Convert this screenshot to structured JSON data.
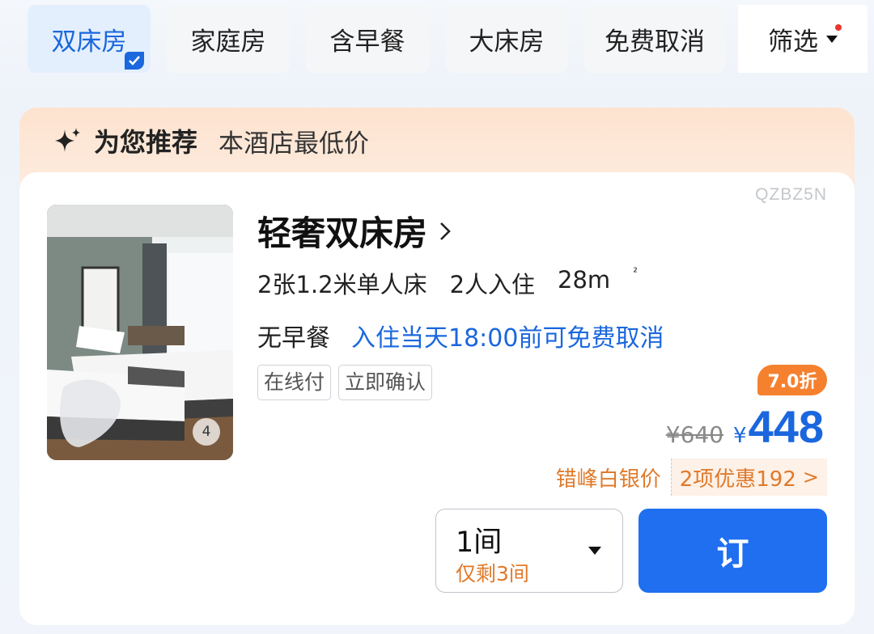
{
  "filters": {
    "chips": [
      {
        "label": "双床房",
        "active": true
      },
      {
        "label": "家庭房",
        "active": false
      },
      {
        "label": "含早餐",
        "active": false
      },
      {
        "label": "大床房",
        "active": false
      },
      {
        "label": "免费取消",
        "active": false
      }
    ],
    "filter_label": "筛选"
  },
  "banner": {
    "title": "为您推荐",
    "subtitle": "本酒店最低价"
  },
  "room": {
    "code": "QZBZ5N",
    "photo_count": "4",
    "name": "轻奢双床房",
    "beds": "2张1.2米单人床",
    "guests": "2人入住",
    "area": "28m",
    "area_sup": "²",
    "breakfast": "无早餐",
    "cancel_policy": "入住当天18:00前可免费取消",
    "tags": [
      "在线付",
      "立即确认"
    ],
    "discount": "7.0折",
    "original_price": "¥640",
    "currency": "¥",
    "price": "448",
    "promo_label": "错峰白银价",
    "promo_detail": "2项优惠192",
    "promo_arrow": ">",
    "quantity": "1间",
    "quantity_left": "仅剩3间",
    "book_label": "订"
  },
  "colors": {
    "accent": "#1a67de",
    "book_button": "#1f6ff0",
    "orange": "#e07a2b",
    "discount_badge": "#f5812f",
    "banner_bg": "#fde3cf"
  },
  "icons": [
    "check-icon",
    "caret-down-icon",
    "sparkle-icon",
    "chevron-right-icon"
  ]
}
